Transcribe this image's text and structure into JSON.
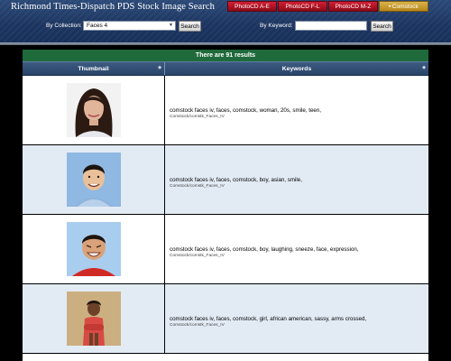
{
  "header": {
    "title": "Richmond Times-Dispatch PDS Stock Image Search",
    "tabs": [
      {
        "label": "PhotoCD A-E",
        "active": false
      },
      {
        "label": "PhotoCD F-L",
        "active": false
      },
      {
        "label": "PhotoCD M-Z",
        "active": false
      },
      {
        "label": "Comstock",
        "active": true,
        "icon": "arrow-right-icon"
      }
    ],
    "collection_label": "By Collection:",
    "collection_value": "Faces 4",
    "search_label": "Search",
    "keyword_label": "By Keyword:",
    "keyword_value": ""
  },
  "results": {
    "summary": "There are 91 results",
    "columns": {
      "thumbnail": "Thumbnail",
      "keywords": "Keywords"
    },
    "rows": [
      {
        "keywords": "comstock faces iv, faces, comstock, woman, 20s, smile, teen,",
        "path": "Comstock/comstk_Faces_IV"
      },
      {
        "keywords": "comstock faces iv, faces, comstock, boy, asian, smile,",
        "path": "Comstock/comstk_Faces_IV"
      },
      {
        "keywords": "comstock faces iv, faces, comstock, boy, laughing, sneeze, face, expression,",
        "path": "Comstock/comstk_Faces_IV"
      },
      {
        "keywords": "comstock faces iv, faces, comstock, girl, african american, sassy, arms crossed,",
        "path": "Comstock/comstk_Faces_IV"
      }
    ]
  },
  "colors": {
    "header_bg": "#1c3560",
    "tab_red": "#c01a2c",
    "tab_active": "#c9a032",
    "results_bar": "#1f6a3a",
    "alt_row": "#e2ebf4"
  }
}
